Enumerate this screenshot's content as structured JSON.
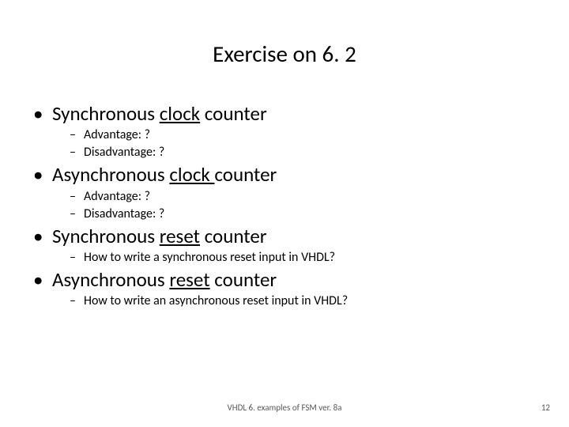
{
  "title": "Exercise on 6. 2",
  "bullets": {
    "b1_pre": "Synchronous ",
    "b1_under": "clock",
    "b1_post": " counter",
    "b1s1": "Advantage: ?",
    "b1s2": "Disadvantage: ?",
    "b2_pre": "Asynchronous ",
    "b2_under": "clock ",
    "b2_post": "counter",
    "b2s1": "Advantage: ?",
    "b2s2": "Disadvantage: ?",
    "b3_pre": "Synchronous ",
    "b3_under": "reset",
    "b3_post": " counter",
    "b3s1": "How to write a synchronous reset input in VHDL?",
    "b4_pre": "Asynchronous ",
    "b4_under": "reset",
    "b4_post": " counter",
    "b4s1": "How to write an asynchronous reset input in VHDL?"
  },
  "footer": {
    "center": "VHDL 6. examples of FSM ver. 8a",
    "right": "12"
  }
}
